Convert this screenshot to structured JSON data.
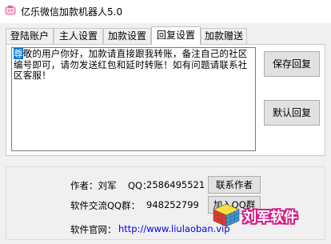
{
  "window": {
    "title": "亿乐微信加款机器人5.0",
    "icon": "app-icon"
  },
  "tabs": [
    {
      "label": "登陆账户",
      "active": false
    },
    {
      "label": "主人设置",
      "active": false
    },
    {
      "label": "加款设置",
      "active": false
    },
    {
      "label": "回复设置",
      "active": true
    },
    {
      "label": "加款赠送",
      "active": false
    }
  ],
  "reply": {
    "message_highlight": "尊",
    "message_rest": "敬的用户你好，加款请直接跟我转账，备注自己的社区编号即可，请勿发送红包和延时转账！如有问题请联系社区客服！",
    "save_label": "保存回复",
    "default_label": "默认回复"
  },
  "info": {
    "author_label": "作者：刘军",
    "qq_label": "QQ：",
    "qq_value": "2586495521",
    "contact_label": "联系作者",
    "group_label": "软件交流QQ群：",
    "group_value": "948252799",
    "join_label": "加入QQ群",
    "site_label": "软件官网：",
    "site_url": "http://www.liulaoban.vip"
  },
  "watermark": {
    "text": "刘军软件"
  },
  "colors": {
    "selection": "#0078d7",
    "link": "#0000ee",
    "watermark_outline": "#d21f8a"
  }
}
